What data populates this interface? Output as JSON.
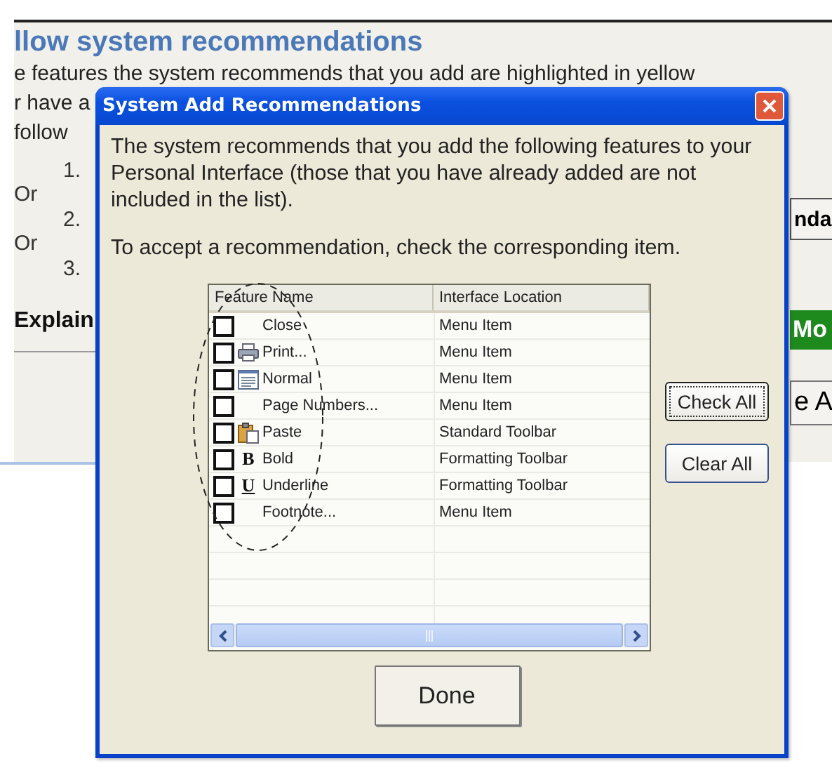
{
  "page": {
    "heading": "llow system recommendations",
    "lines": [
      "e features the system recommends that you add are highlighted in yellow",
      "r have a",
      "follow"
    ],
    "steps": [
      {
        "kind": "step",
        "text": "1."
      },
      {
        "kind": "or",
        "text": "Or"
      },
      {
        "kind": "step",
        "text": "2."
      },
      {
        "kind": "or",
        "text": "Or"
      },
      {
        "kind": "step",
        "text": "3."
      }
    ],
    "explain": "Explain",
    "side_buttons": [
      {
        "kind": "outline",
        "label": "nda"
      },
      {
        "kind": "green",
        "label": "Mo"
      },
      {
        "kind": "large",
        "label": "e A"
      }
    ]
  },
  "dialog": {
    "title": "System Add Recommendations",
    "intro": "The system recommends that you add the following features to your Personal Interface (those that you have already added are not included in the list).",
    "instruction": "To accept a recommendation, check the corresponding item.",
    "columns": [
      "Feature Name",
      "Interface Location"
    ],
    "rows": [
      {
        "kind": "none",
        "name": "Close",
        "location": "Menu Item",
        "checked": false
      },
      {
        "kind": "printer",
        "name": "Print...",
        "location": "Menu Item",
        "checked": false
      },
      {
        "kind": "document",
        "name": "Normal",
        "location": "Menu Item",
        "checked": false
      },
      {
        "kind": "none",
        "name": "Page Numbers...",
        "location": "Menu Item",
        "checked": false
      },
      {
        "kind": "paste",
        "name": "Paste",
        "location": "Standard Toolbar",
        "checked": false
      },
      {
        "kind": "glyph",
        "glyph": "B",
        "name": "Bold",
        "location": "Formatting Toolbar",
        "checked": false
      },
      {
        "kind": "glyph",
        "glyph": "U",
        "underline": true,
        "name": "Underline",
        "location": "Formatting Toolbar",
        "checked": false
      },
      {
        "kind": "none",
        "name": "Footnote...",
        "location": "Menu Item",
        "checked": false
      }
    ],
    "buttons": [
      "Check All",
      "Clear All"
    ],
    "done": "Done"
  }
}
